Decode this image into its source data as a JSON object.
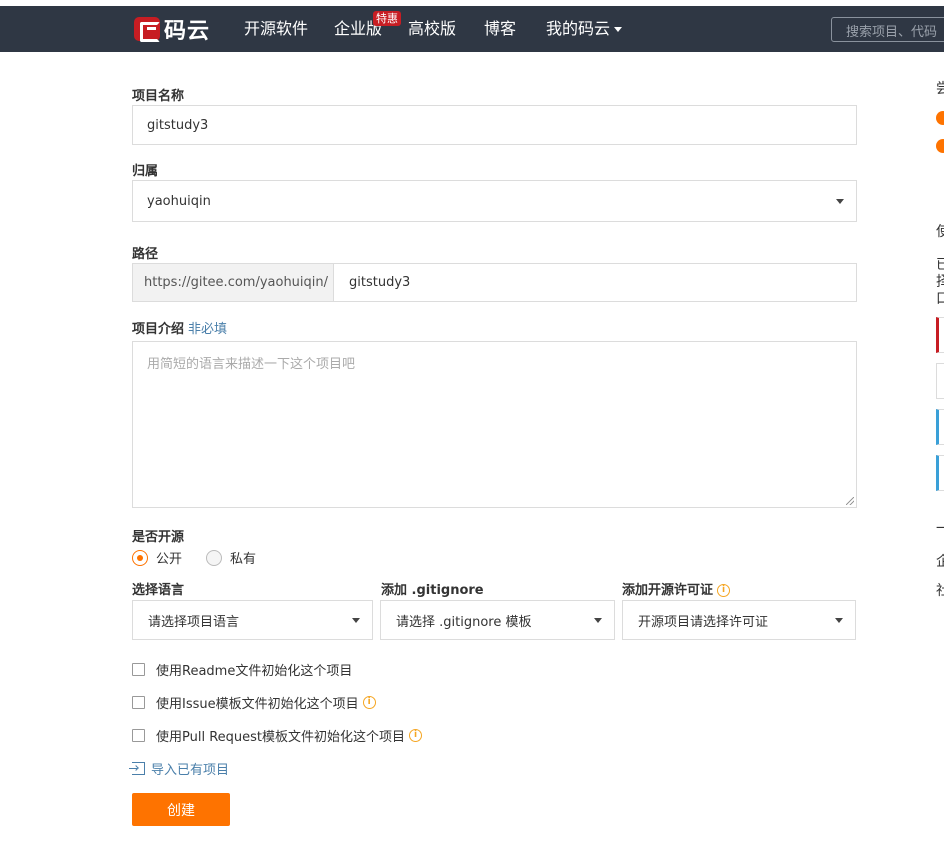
{
  "nav": {
    "logo_text": "码云",
    "items": [
      "开源软件",
      "企业版",
      "高校版",
      "博客",
      "我的码云"
    ],
    "badge": "特惠",
    "search_placeholder": "搜索项目、代码"
  },
  "form": {
    "name_label": "项目名称",
    "name_value": "gitstudy3",
    "owner_label": "归属",
    "owner_value": "yaohuiqin",
    "path_label": "路径",
    "path_prefix": "https://gitee.com/yaohuiqin/",
    "path_value": "gitstudy3",
    "desc_label": "项目介绍",
    "desc_optional": "非必填",
    "desc_placeholder": "用简短的语言来描述一下这个项目吧",
    "open_label": "是否开源",
    "radio_public": "公开",
    "radio_private": "私有",
    "lang_label": "选择语言",
    "lang_value": "请选择项目语言",
    "gitignore_label": "添加 .gitignore",
    "gitignore_value": "请选择 .gitignore 模板",
    "license_label": "添加开源许可证",
    "license_value": "开源项目请选择许可证",
    "checkbox_readme": "使用Readme文件初始化这个项目",
    "checkbox_issue": "使用Issue模板文件初始化这个项目",
    "checkbox_pr": "使用Pull Request模板文件初始化这个项目",
    "import_link": "导入已有项目",
    "create_button": "创建"
  },
  "right_panel": {
    "glyphs": [
      "尝",
      "使",
      "已",
      "择",
      "口",
      "一",
      "企",
      "社"
    ]
  },
  "colors": {
    "nav_bg": "#2f3744",
    "accent": "#fe7300",
    "brand_red": "#c71d23",
    "link": "#4a7faa"
  }
}
